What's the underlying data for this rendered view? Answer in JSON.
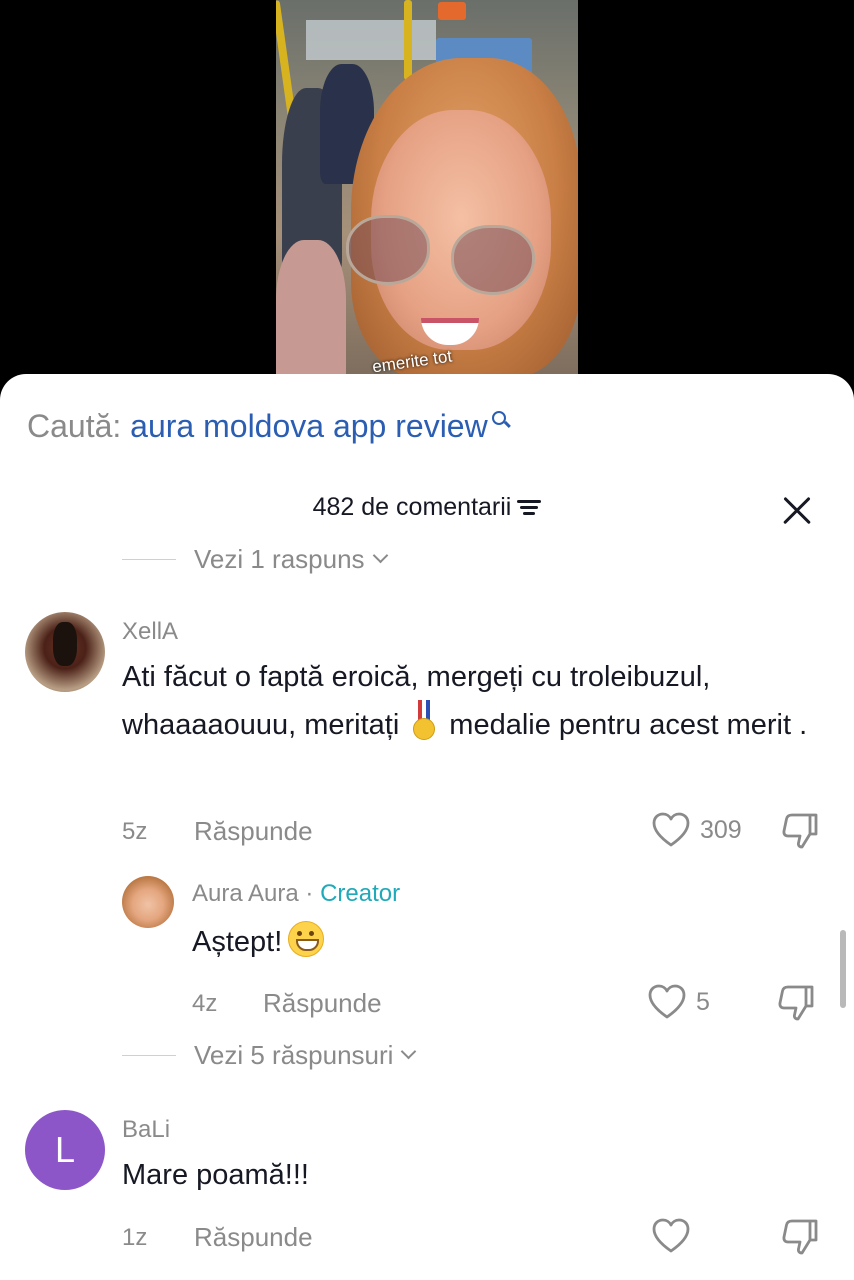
{
  "video": {
    "caption": "emerite tot"
  },
  "search": {
    "prefix": "Caută:",
    "query": "aura moldova app review"
  },
  "comments_header": {
    "title": "482 de comentarii"
  },
  "replies_toggle_top": {
    "label": "Vezi 1 raspuns"
  },
  "comments": [
    {
      "username": "XellA",
      "text_before_emoji": "Ati făcut o faptă eroică, mergeți cu troleibuzul, whaaaaouuu, meritați",
      "emoji": "medal",
      "text_after_emoji": "medalie pentru acest merit .",
      "time": "5z",
      "reply_label": "Răspunde",
      "likes": "309"
    },
    {
      "username": "Aura Aura",
      "separator": "·",
      "badge": "Creator",
      "text": "Aștept!",
      "emoji": "grinning-face",
      "time": "4z",
      "reply_label": "Răspunde",
      "likes": "5"
    },
    {
      "username": "BaLi",
      "avatar_letter": "L",
      "text": "Mare poamă!!!",
      "time": "1z",
      "reply_label": "Răspunde",
      "likes": ""
    }
  ],
  "replies_toggle_xella": {
    "label": "Vezi 5 răspunsuri"
  },
  "colors": {
    "accent_link": "#2b5eb2",
    "creator_badge": "#20a9b8",
    "muted_text": "#8a8a8a",
    "avatar_bali": "#8c56c8"
  },
  "icons": [
    "search-icon",
    "filter-icon",
    "close-icon",
    "heart-icon",
    "dislike-icon",
    "chevron-down-icon",
    "medal-emoji",
    "grin-emoji"
  ]
}
